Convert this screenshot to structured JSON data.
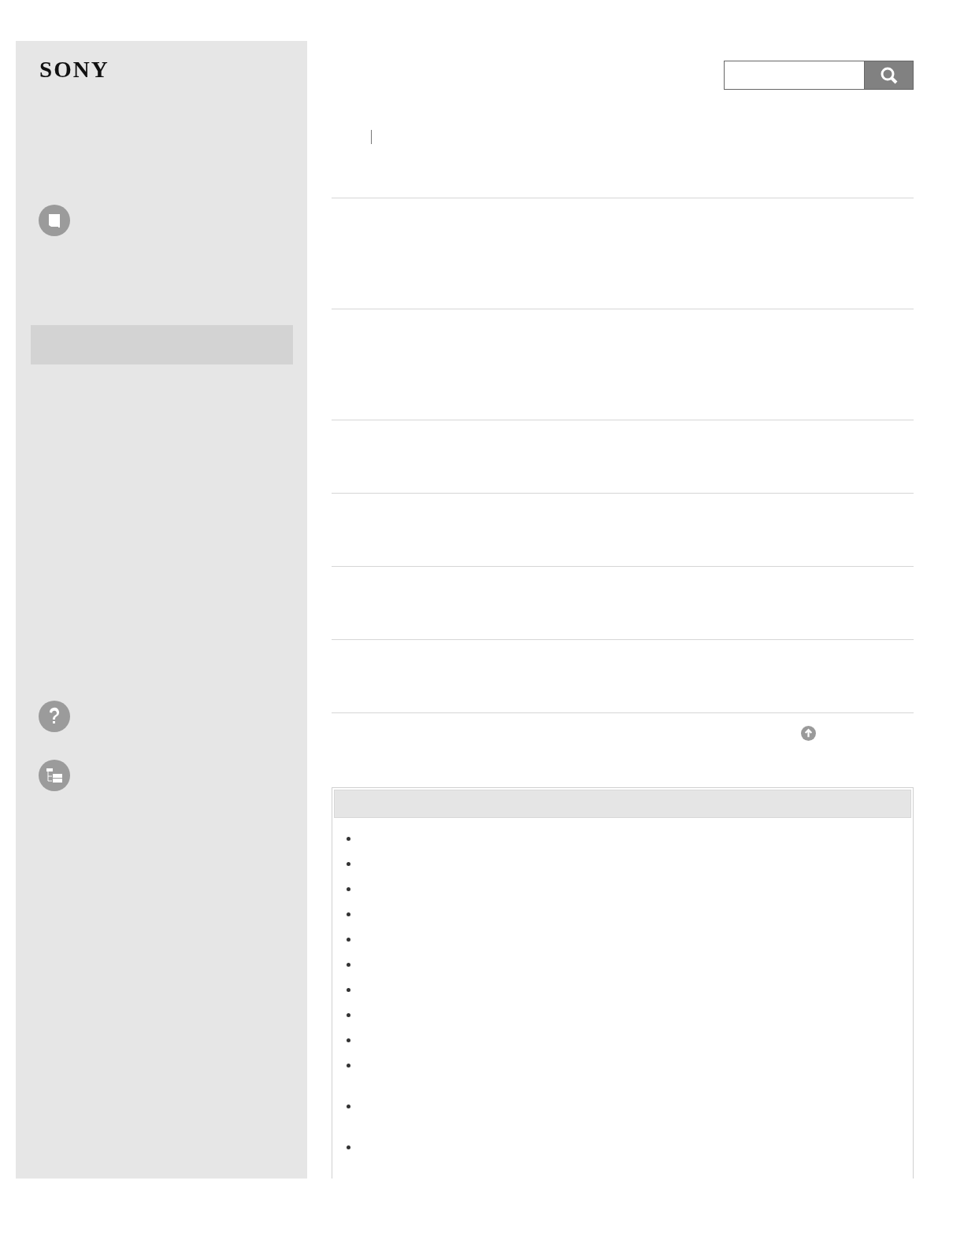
{
  "header": {
    "logo": "SONY"
  },
  "sidebar": {
    "items": [
      {
        "kind": "book",
        "selected": false
      },
      {
        "kind": "blank",
        "selected": true
      },
      {
        "kind": "help",
        "selected": false
      },
      {
        "kind": "tree",
        "selected": false
      }
    ]
  },
  "sections": [
    {
      "kind": "tall"
    },
    {
      "kind": "tall"
    },
    {
      "kind": "short"
    },
    {
      "kind": "short"
    },
    {
      "kind": "short"
    },
    {
      "kind": "short"
    }
  ],
  "panel": {
    "items": [
      {
        "kind": "single"
      },
      {
        "kind": "single"
      },
      {
        "kind": "single"
      },
      {
        "kind": "single"
      },
      {
        "kind": "single"
      },
      {
        "kind": "single"
      },
      {
        "kind": "single"
      },
      {
        "kind": "single"
      },
      {
        "kind": "single"
      },
      {
        "kind": "double"
      },
      {
        "kind": "double"
      },
      {
        "kind": "double"
      }
    ]
  }
}
